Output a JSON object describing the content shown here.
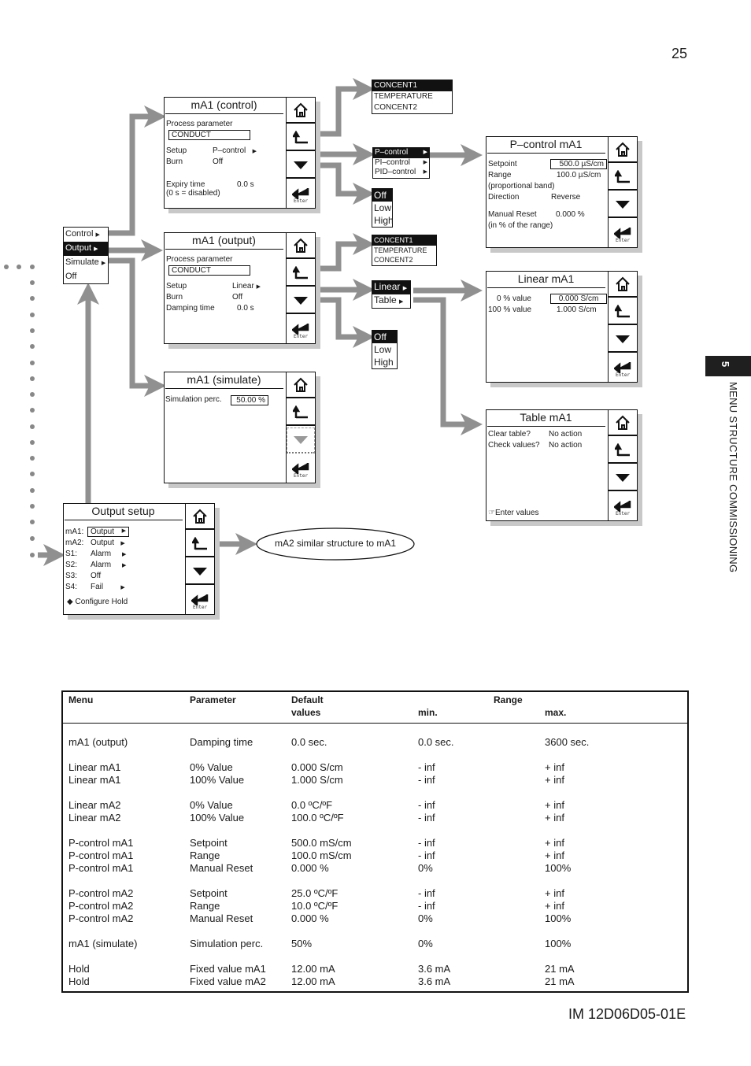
{
  "page": {
    "number": "25",
    "doc_id": "IM 12D06D05-01E",
    "chapter_number": "5",
    "chapter_title": "MENU STRUCTURE COMMISSIONING"
  },
  "main_menu": {
    "items": [
      {
        "label": "Control",
        "submenu": true,
        "selected": false
      },
      {
        "label": "Output",
        "submenu": true,
        "selected": true
      },
      {
        "label": "Simulate",
        "submenu": true,
        "selected": false
      },
      {
        "label": "Off",
        "submenu": false,
        "selected": false
      }
    ]
  },
  "screens": {
    "mA1_control": {
      "title": "mA1 (control)",
      "process_label": "Process parameter",
      "process_value": "CONDUCT",
      "setup_label": "Setup",
      "setup_value": "P–control",
      "burn_label": "Burn",
      "burn_value": "Off",
      "expiry_label": "Expiry time",
      "expiry_value": "0.0 s",
      "expiry_note": "(0 s = disabled)"
    },
    "mA1_output": {
      "title": "mA1 (output)",
      "process_label": "Process parameter",
      "process_value": "CONDUCT",
      "setup_label": "Setup",
      "setup_value": "Linear",
      "burn_label": "Burn",
      "burn_value": "Off",
      "damping_label": "Damping time",
      "damping_value": "0.0 s"
    },
    "mA1_simulate": {
      "title": "mA1 (simulate)",
      "sim_label": "Simulation perc.",
      "sim_value": "50.00 %"
    },
    "output_setup": {
      "title": "Output setup",
      "rows": [
        {
          "key": "mA1:",
          "value": "Output",
          "submenu": true
        },
        {
          "key": "mA2:",
          "value": "Output",
          "submenu": true
        },
        {
          "key": "S1:",
          "value": "Alarm",
          "submenu": true
        },
        {
          "key": "S2:",
          "value": "Alarm",
          "submenu": true
        },
        {
          "key": "S3:",
          "value": "Off",
          "submenu": false
        },
        {
          "key": "S4:",
          "value": "Fail",
          "submenu": true
        }
      ],
      "hold_label": "◆ Configure Hold"
    },
    "pcontrol_mA1": {
      "title": "P–control mA1",
      "setpoint_label": "Setpoint",
      "setpoint_value": "500.0 µS/cm",
      "range_label": "Range",
      "range_value": "100.0 µS/cm",
      "range_note": "(proportional band)",
      "direction_label": "Direction",
      "direction_value": "Reverse",
      "reset_label": "Manual Reset",
      "reset_value": "0.000 %",
      "reset_note": "(in % of the range)"
    },
    "linear_mA1": {
      "title": "Linear mA1",
      "zero_label": "0 % value",
      "zero_value": "0.000 S/cm",
      "full_label": "100 % value",
      "full_value": "1.000 S/cm"
    },
    "table_mA1": {
      "title": "Table mA1",
      "clear_label": "Clear table?",
      "clear_value": "No action",
      "check_label": "Check values?",
      "check_value": "No action",
      "enter_label": "Enter values"
    },
    "buttons": {
      "enter_label": "Enter"
    }
  },
  "popups": {
    "param_control": [
      "CONCENT1",
      "TEMPERATURE",
      "CONCENT2"
    ],
    "control_type": [
      "P–control",
      "PI–control",
      "PID–control"
    ],
    "burn_control": [
      "Off",
      "Low",
      "High"
    ],
    "param_output": [
      "CONCENT1",
      "TEMPERATURE",
      "CONCENT2"
    ],
    "output_type": [
      "Linear",
      "Table"
    ],
    "burn_output": [
      "Off",
      "Low",
      "High"
    ]
  },
  "note_bubble": "mA2 similar structure to mA1",
  "table": {
    "headers": {
      "menu": "Menu",
      "parameter": "Parameter",
      "default_1": "Default",
      "default_2": "values",
      "range": "Range",
      "min": "min.",
      "max": "max."
    },
    "groups": [
      [
        [
          "mA1 (output)",
          "Damping time",
          "0.0 sec.",
          "0.0 sec.",
          "3600 sec."
        ]
      ],
      [
        [
          "Linear mA1",
          "0% Value",
          "0.000 S/cm",
          "- inf",
          "+ inf"
        ],
        [
          "Linear mA1",
          "100% Value",
          "1.000 S/cm",
          "- inf",
          "+ inf"
        ]
      ],
      [
        [
          "Linear mA2",
          "0% Value",
          "0.0 ºC/ºF",
          "- inf",
          "+ inf"
        ],
        [
          "Linear mA2",
          "100% Value",
          "100.0 ºC/ºF",
          "- inf",
          "+ inf"
        ]
      ],
      [
        [
          "P-control mA1",
          "Setpoint",
          "500.0 mS/cm",
          "- inf",
          "+ inf"
        ],
        [
          "P-control mA1",
          "Range",
          "100.0 mS/cm",
          "- inf",
          "+ inf"
        ],
        [
          "P-control mA1",
          "Manual Reset",
          "0.000 %",
          "0%",
          "100%"
        ]
      ],
      [
        [
          "P-control mA2",
          "Setpoint",
          "25.0 ºC/ºF",
          "- inf",
          "+ inf"
        ],
        [
          "P-control mA2",
          "Range",
          "10.0 ºC/ºF",
          "- inf",
          "+ inf"
        ],
        [
          "P-control mA2",
          "Manual Reset",
          "0.000 %",
          "0%",
          "100%"
        ]
      ],
      [
        [
          "mA1 (simulate)",
          "Simulation perc.",
          "50%",
          "0%",
          "100%"
        ]
      ],
      [
        [
          "Hold",
          "Fixed value mA1",
          "12.00 mA",
          "3.6 mA",
          "21 mA"
        ],
        [
          "Hold",
          "Fixed value mA2",
          "12.00 mA",
          "3.6 mA",
          "21 mA"
        ]
      ]
    ]
  }
}
